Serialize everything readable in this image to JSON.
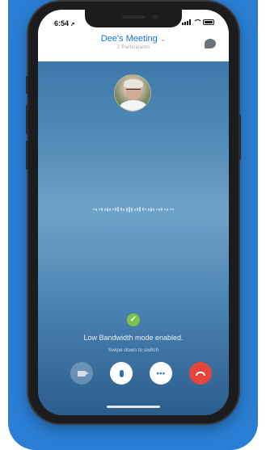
{
  "colors": {
    "card_background": "#2a7ed3",
    "meeting_title": "#1e6fd0",
    "end_call": "#e3463c",
    "check_green": "#7cc34a"
  },
  "status_bar": {
    "time": "6:54",
    "location_icon": "location-arrow-icon",
    "signal_icon": "signal-bars-icon",
    "wifi_icon": "wifi-icon",
    "battery_icon": "battery-icon"
  },
  "meeting": {
    "title": "Dee's Meeting",
    "title_chevron": "chevron-down-icon",
    "participants": "2 Participants",
    "chat_icon": "chat-bubble-icon"
  },
  "call": {
    "avatar_icon": "participant-avatar",
    "waveform_icon": "audio-waveform-icon",
    "status_icon": "check-circle-icon",
    "status_message": "Low Bandwidth mode enabled.",
    "status_hint": "Swipe down to switch"
  },
  "controls": {
    "video_icon": "video-camera-icon",
    "mic_icon": "microphone-icon",
    "more_icon": "more-icon",
    "more_glyph": "•••",
    "end_icon": "end-call-icon"
  }
}
